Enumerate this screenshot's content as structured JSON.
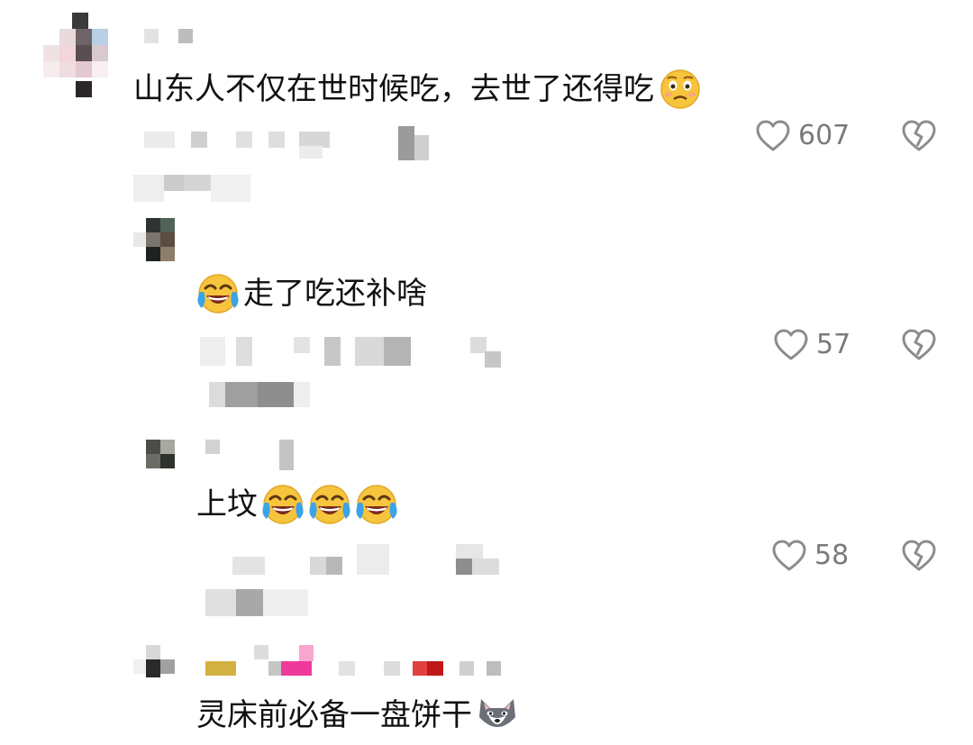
{
  "comments": [
    {
      "text": "山东人不仅在世时候吃，去世了还得吃",
      "emoji": "worried-face",
      "likes": "607"
    },
    {
      "text": "走了吃还补啥",
      "emoji": "laughing-crying-face",
      "likes": "57"
    },
    {
      "text": "上坟",
      "emoji": "laughing-crying-face",
      "likes": "58"
    },
    {
      "text": "灵床前必备一盘饼干",
      "emoji": "wolf-face"
    }
  ],
  "icons": {
    "like": "heart-outline-icon",
    "dislike": "broken-heart-icon"
  },
  "colors": {
    "text": "#111111",
    "muted": "#7a7a7a",
    "icon": "#8c8c8c",
    "emoji_yellow": "#f7c43d",
    "emoji_blue": "#3ba3e8"
  }
}
